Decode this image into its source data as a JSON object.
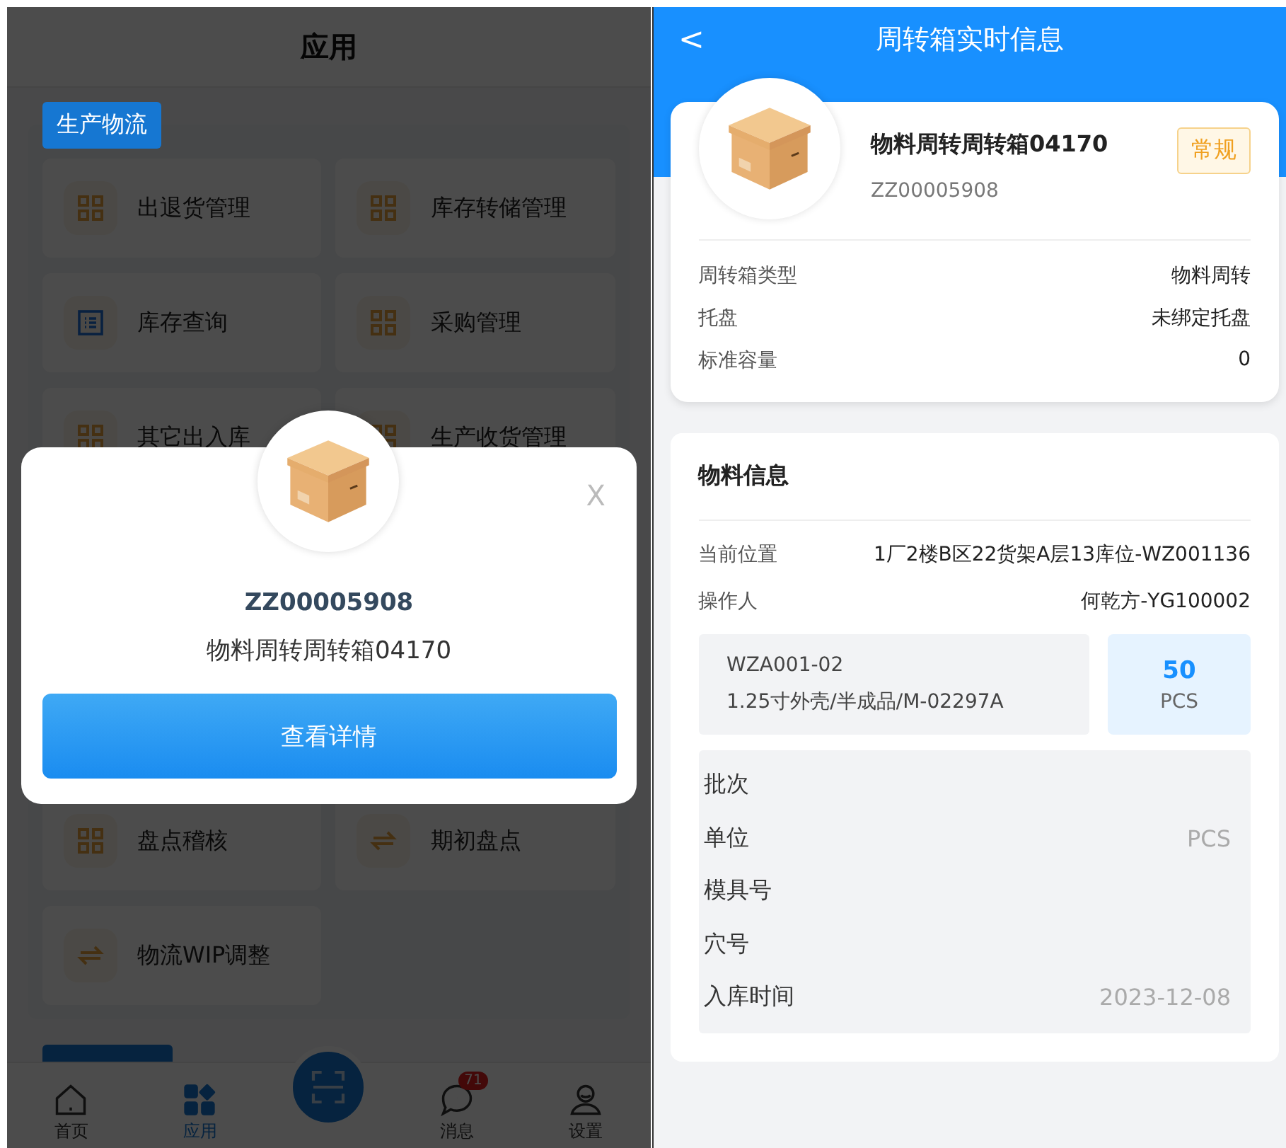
{
  "left_screen": {
    "title": "应用",
    "section": {
      "label": "生产物流"
    },
    "apps": [
      {
        "label": "出退货管理",
        "kind": "grid"
      },
      {
        "label": "库存转储管理",
        "kind": "grid"
      },
      {
        "label": "库存查询",
        "kind": "list"
      },
      {
        "label": "采购管理",
        "kind": "grid"
      },
      {
        "label": "其它出入库",
        "kind": "grid"
      },
      {
        "label": "生产收货管理",
        "kind": "grid"
      }
    ],
    "apps_below": [
      {
        "label": "盘点稽核",
        "kind": "grid"
      },
      {
        "label": "期初盘点",
        "kind": "swap"
      },
      {
        "label": "物流WIP调整",
        "kind": "swap"
      }
    ],
    "tab_bar": [
      {
        "label": "首页",
        "kind": "home",
        "selected": false
      },
      {
        "label": "应用",
        "kind": "apps",
        "selected": true
      },
      {
        "kind": "scan",
        "selected": false
      },
      {
        "label": "消息",
        "kind": "chat",
        "selected": false,
        "badge": "71"
      },
      {
        "label": "设置",
        "kind": "user",
        "selected": false
      }
    ],
    "popup": {
      "code": "ZZ00005908",
      "name": "物料周转周转箱04170",
      "close": "X",
      "button": "查看详情"
    }
  },
  "right_screen": {
    "back": "<",
    "title": "周转箱实时信息",
    "box": {
      "name": "物料周转周转箱04170",
      "code": "ZZ00005908",
      "tag": "常规",
      "fields": [
        {
          "label": "周转箱类型",
          "value": "物料周转"
        },
        {
          "label": "托盘",
          "value": "未绑定托盘"
        },
        {
          "label": "标准容量",
          "value": "0"
        }
      ]
    },
    "material": {
      "title": "物料信息",
      "fields": [
        {
          "label": "当前位置",
          "value": "1厂2楼B区22货架A层13库位-WZ001136"
        },
        {
          "label": "操作人",
          "value": "何乾方-YG100002"
        }
      ],
      "item": {
        "code": "WZA001-02",
        "description": "1.25寸外壳/半成品/M-02297A",
        "quantity": "50",
        "unit": "PCS"
      },
      "details": [
        {
          "label": "批次"
        },
        {
          "label": "单位",
          "value": "PCS"
        },
        {
          "label": "模具号"
        },
        {
          "label": "穴号"
        },
        {
          "label": "入库时间",
          "value": "2023-12-08"
        }
      ]
    }
  }
}
